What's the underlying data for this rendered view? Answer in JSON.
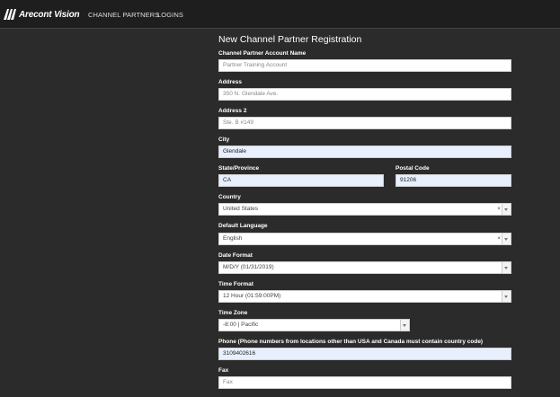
{
  "header": {
    "logo_text": "Arecont Vision",
    "nav": [
      "CHANNEL PARTNERS",
      "LOGINS"
    ]
  },
  "form": {
    "title": "New Channel Partner Registration",
    "account_name": {
      "label": "Channel Partner Account Name",
      "value": "",
      "placeholder": "Partner Training Account"
    },
    "address": {
      "label": "Address",
      "value": "",
      "placeholder": "350 N. Glendale Ave."
    },
    "address2": {
      "label": "Address 2",
      "value": "",
      "placeholder": "Ste. B #149"
    },
    "city": {
      "label": "City",
      "value": "Glendale"
    },
    "state": {
      "label": "State/Province",
      "value": "CA"
    },
    "postal": {
      "label": "Postal Code",
      "value": "91206"
    },
    "country": {
      "label": "Country",
      "value": "United States",
      "clear": "×"
    },
    "language": {
      "label": "Default Language",
      "value": "English",
      "clear": "×"
    },
    "date_format": {
      "label": "Date Format",
      "value": "M/D/Y (01/31/2019)"
    },
    "time_format": {
      "label": "Time Format",
      "value": "12 Hour (01:59:00PM)"
    },
    "time_zone": {
      "label": "Time Zone",
      "value": "-8:00 | Pacific"
    },
    "phone": {
      "label": "Phone (Phone numbers from locations other than USA and Canada must contain country code)",
      "value": "3109402616"
    },
    "fax": {
      "label": "Fax",
      "value": "",
      "placeholder": "Fax"
    }
  }
}
